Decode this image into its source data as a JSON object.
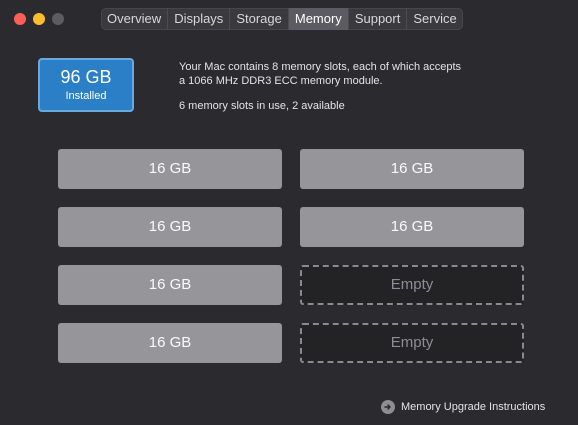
{
  "window": {
    "traffic_lights": [
      "close",
      "minimize",
      "zoom"
    ]
  },
  "tabs": [
    {
      "label": "Overview",
      "active": false
    },
    {
      "label": "Displays",
      "active": false
    },
    {
      "label": "Storage",
      "active": false
    },
    {
      "label": "Memory",
      "active": true
    },
    {
      "label": "Support",
      "active": false
    },
    {
      "label": "Service",
      "active": false
    }
  ],
  "memory": {
    "installed_amount": "96 GB",
    "installed_label": "Installed",
    "description_line1": "Your Mac contains 8 memory slots, each of which accepts",
    "description_line2": "a 1066 MHz DDR3 ECC memory module.",
    "usage": "6 memory slots in use, 2 available",
    "slots": [
      {
        "label": "16 GB",
        "filled": true
      },
      {
        "label": "16 GB",
        "filled": true
      },
      {
        "label": "16 GB",
        "filled": true
      },
      {
        "label": "16 GB",
        "filled": true
      },
      {
        "label": "16 GB",
        "filled": true
      },
      {
        "label": "Empty",
        "filled": false
      },
      {
        "label": "16 GB",
        "filled": true
      },
      {
        "label": "Empty",
        "filled": false
      }
    ],
    "upgrade_link": "Memory Upgrade Instructions"
  },
  "colors": {
    "background": "#2b2a2e",
    "accent": "#2a7fc6",
    "filled_slot": "#969599"
  }
}
